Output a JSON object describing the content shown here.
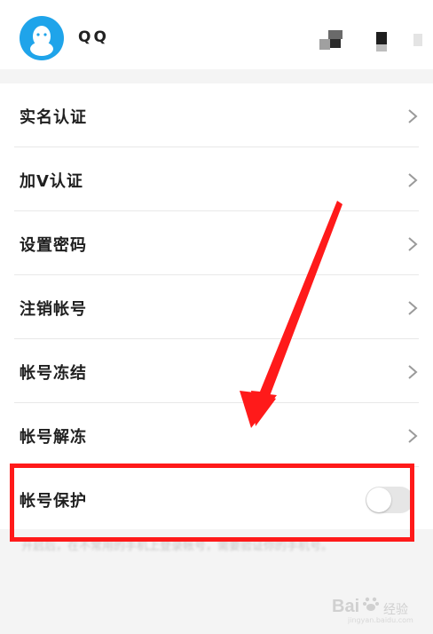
{
  "header": {
    "account_name": "QQ",
    "avatar_icon": "qq-penguin-icon",
    "avatar_color": "#1fa4ea"
  },
  "settings": {
    "items": [
      {
        "label": "实名认证",
        "icon": "chevron-right-icon"
      },
      {
        "label": "加V认证",
        "icon": "chevron-right-icon"
      },
      {
        "label": "设置密码",
        "icon": "chevron-right-icon"
      },
      {
        "label": "注销帐号",
        "icon": "chevron-right-icon"
      },
      {
        "label": "帐号冻结",
        "icon": "chevron-right-icon"
      },
      {
        "label": "帐号解冻",
        "icon": "chevron-right-icon"
      }
    ],
    "protection": {
      "label": "帐号保护",
      "enabled": false
    }
  },
  "footnote": "开启后，在不常用的手机上登录帐号，需要验证你的手机号。",
  "annotation": {
    "color": "#ff1a1a"
  },
  "watermark": {
    "text": "Bai",
    "sub": "经验",
    "url": "jingyan.baidu.com"
  }
}
